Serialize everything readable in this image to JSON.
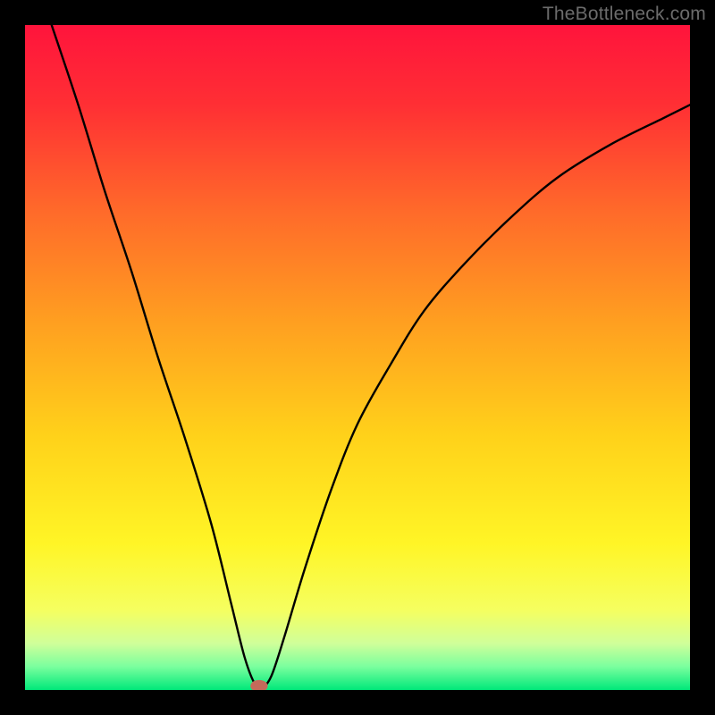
{
  "watermark": "TheBottleneck.com",
  "chart_data": {
    "type": "line",
    "title": "",
    "xlabel": "",
    "ylabel": "",
    "xlim": [
      0,
      100
    ],
    "ylim": [
      0,
      100
    ],
    "grid": false,
    "legend": false,
    "gradient_stops": [
      {
        "offset": 0,
        "color": "#ff143c"
      },
      {
        "offset": 0.12,
        "color": "#ff2f34"
      },
      {
        "offset": 0.28,
        "color": "#ff6a2a"
      },
      {
        "offset": 0.45,
        "color": "#ffa020"
      },
      {
        "offset": 0.62,
        "color": "#ffd21a"
      },
      {
        "offset": 0.78,
        "color": "#fff526"
      },
      {
        "offset": 0.88,
        "color": "#f5ff60"
      },
      {
        "offset": 0.93,
        "color": "#d0ff9a"
      },
      {
        "offset": 0.965,
        "color": "#7aff9e"
      },
      {
        "offset": 1.0,
        "color": "#00e87a"
      }
    ],
    "series": [
      {
        "name": "bottleneck-curve",
        "color": "#000000",
        "x": [
          4,
          8,
          12,
          16,
          20,
          24,
          28,
          31,
          33,
          34.5,
          35.5,
          37,
          39,
          42,
          46,
          50,
          55,
          60,
          66,
          73,
          80,
          88,
          96,
          100
        ],
        "y": [
          100,
          88,
          75,
          63,
          50,
          38,
          25,
          13,
          5,
          1,
          0.3,
          2,
          8,
          18,
          30,
          40,
          49,
          57,
          64,
          71,
          77,
          82,
          86,
          88
        ]
      }
    ],
    "marker": {
      "name": "min-point",
      "x": 35.2,
      "y": 0.6,
      "rx": 1.3,
      "ry": 0.9,
      "fill": "#c46a5a"
    }
  }
}
